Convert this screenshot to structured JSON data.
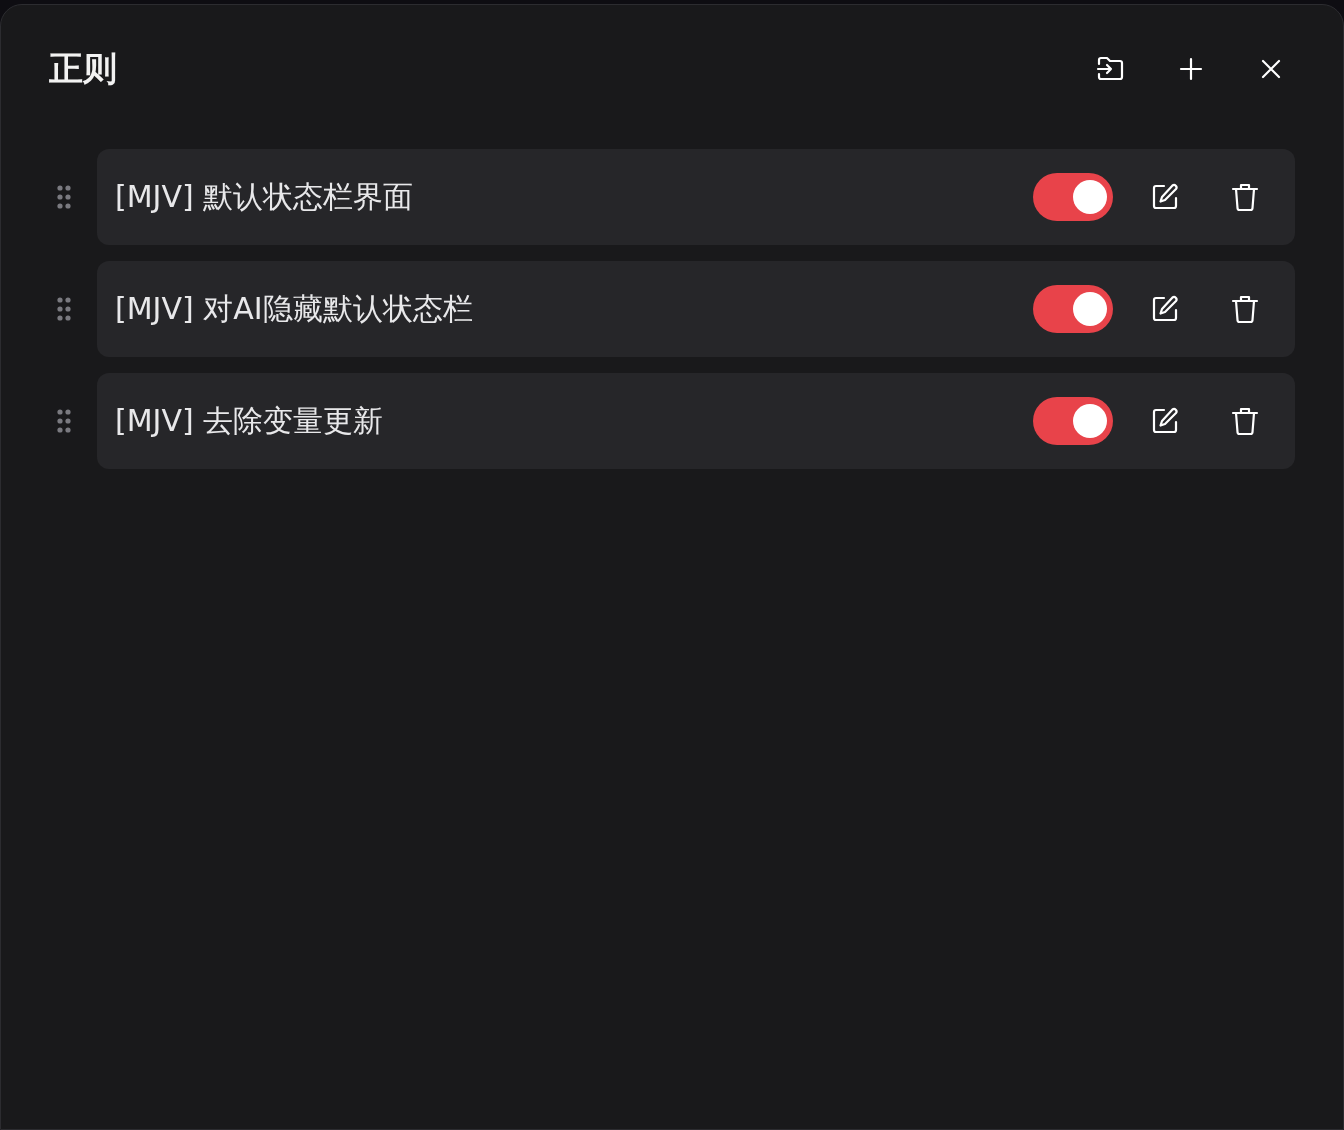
{
  "dialog": {
    "title": "正则"
  },
  "rules": [
    {
      "label": "[MJV] 默认状态栏界面",
      "on": true
    },
    {
      "label": "[MJV] 对AI隐藏默认状态栏",
      "on": true
    },
    {
      "label": "[MJV] 去除变量更新",
      "on": true
    }
  ]
}
